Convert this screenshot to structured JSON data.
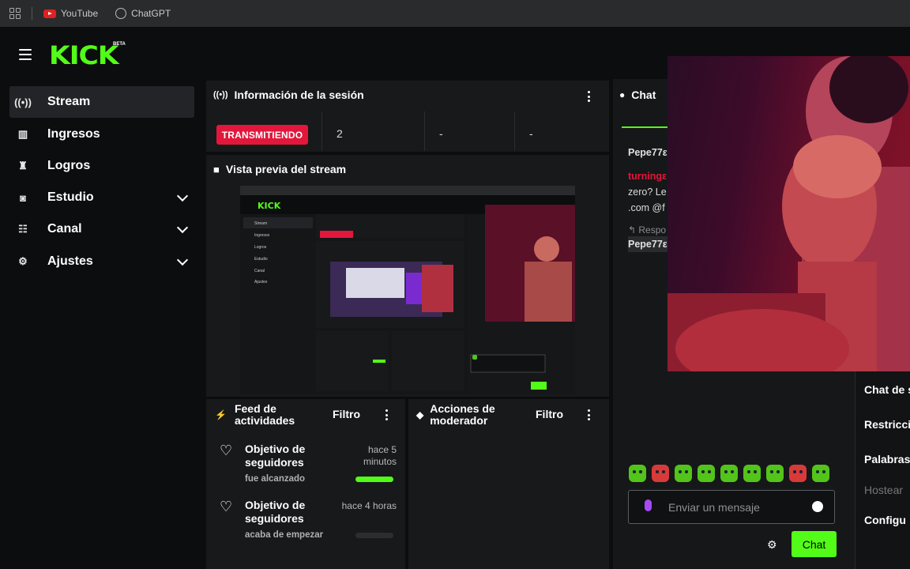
{
  "bookmarks": [
    {
      "label": "YouTube",
      "icon": "youtube-icon"
    },
    {
      "label": "ChatGPT",
      "icon": "chatgpt-icon"
    }
  ],
  "brand": {
    "logo": "KICK",
    "badge": "BETA",
    "accent": "#53fc18"
  },
  "sidebar": {
    "items": [
      {
        "label": "Stream",
        "icon": "broadcast-icon",
        "active": true
      },
      {
        "label": "Ingresos",
        "icon": "chart-icon"
      },
      {
        "label": "Logros",
        "icon": "trophy-icon"
      },
      {
        "label": "Estudio",
        "icon": "camera-icon",
        "expandable": true
      },
      {
        "label": "Canal",
        "icon": "users-icon",
        "expandable": true
      },
      {
        "label": "Ajustes",
        "icon": "gear-icon",
        "expandable": true
      }
    ]
  },
  "session": {
    "title": "Información de la sesión",
    "status": "TRANSMITIENDO",
    "status_color": "#e2173b",
    "stats": [
      "2",
      "-",
      "-"
    ]
  },
  "preview": {
    "title": "Vista previa del stream"
  },
  "feed": {
    "title": "Feed de actividades",
    "filter": "Filtro",
    "items": [
      {
        "title": "Objetivo de seguidores",
        "sub": "fue alcanzado",
        "time": "hace 5 minutos",
        "progress": 1.0
      },
      {
        "title": "Objetivo de seguidores",
        "sub": "acaba de empezar",
        "time": "hace 4 horas",
        "progress": 0.0
      }
    ]
  },
  "mod": {
    "title": "Acciones de moderador",
    "filter": "Filtro"
  },
  "chat": {
    "title": "Chat",
    "messages": [
      "Pepe77ε",
      "turningε",
      "zero? Le",
      ".com @f",
      "↰ Respo",
      "Pepe77ε"
    ],
    "input_placeholder": "Enviar un mensaje",
    "send_label": "Chat"
  },
  "chat_settings": {
    "items": [
      "Chat de s",
      "Restricci",
      "Palabras",
      "Hostear",
      "Configu"
    ]
  }
}
